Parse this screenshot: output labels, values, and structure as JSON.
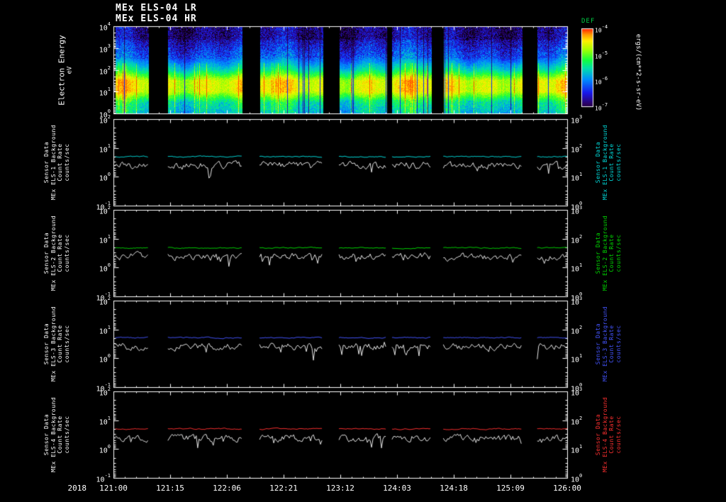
{
  "window": {
    "background": "#000000"
  },
  "header": {
    "title_line1": "MEx ELS-04 LR",
    "title_line2": "MEx ELS-04 HR"
  },
  "spectrogram": {
    "ylabel": "Electron Energy",
    "yunits": "eV",
    "ytick_exponents": [
      4,
      3,
      2,
      1,
      0
    ]
  },
  "colorbar": {
    "label": "DEF",
    "label_color": "#00cc44",
    "tick_exponents": [
      -4,
      -5,
      -6,
      -7
    ],
    "units": "ergs/(cm**2-s-sr-eV)"
  },
  "line_panels": [
    {
      "name": "MEx ELS-1 Background",
      "color": "#00dddd",
      "label_lines": [
        "Sensor Data",
        "MEx ELS-1 Background",
        "Count Rate",
        "counts/sec"
      ],
      "left_tick_exponents": [
        2,
        1,
        0,
        -1
      ],
      "right_tick_exponents": [
        3,
        2,
        1,
        0
      ]
    },
    {
      "name": "MEx ELS-2 Background",
      "color": "#00d800",
      "label_lines": [
        "Sensor Data",
        "MEx ELS-2 Background",
        "Count Rate",
        "counts/sec"
      ],
      "left_tick_exponents": [
        2,
        1,
        0,
        -1
      ],
      "right_tick_exponents": [
        3,
        2,
        1,
        0
      ]
    },
    {
      "name": "MEx ELS-3 Background",
      "color": "#4455ff",
      "label_lines": [
        "Sensor Data",
        "MEx ELS-3 Background",
        "Count Rate",
        "counts/sec"
      ],
      "left_tick_exponents": [
        2,
        1,
        0,
        -1
      ],
      "right_tick_exponents": [
        3,
        2,
        1,
        0
      ]
    },
    {
      "name": "MEx ELS-4 Background",
      "color": "#ff3030",
      "label_lines": [
        "Sensor Data",
        "MEx ELS-4 Background",
        "Count Rate",
        "counts/sec"
      ],
      "left_tick_exponents": [
        2,
        1,
        0,
        -1
      ],
      "right_tick_exponents": [
        3,
        2,
        1,
        0
      ]
    }
  ],
  "xaxis": {
    "year_label": "2018",
    "tick_labels": [
      "121:00",
      "121:15",
      "122:06",
      "122:21",
      "123:12",
      "124:03",
      "124:18",
      "125:09",
      "126:00"
    ]
  },
  "chart_data": {
    "type": "heatmap+line",
    "time_axis": {
      "year": 2018,
      "format": "DOY:HH",
      "tick_labels": [
        "121:00",
        "121:15",
        "122:06",
        "122:21",
        "123:12",
        "124:03",
        "124:18",
        "125:09",
        "126:00"
      ],
      "span_hours": 120,
      "hours_per_major_tick": 15
    },
    "data_segments_frac": [
      [
        0.004,
        0.078
      ],
      [
        0.12,
        0.283
      ],
      [
        0.322,
        0.462
      ],
      [
        0.497,
        0.602
      ],
      [
        0.614,
        0.7
      ],
      [
        0.727,
        0.9
      ],
      [
        0.934,
        1.0
      ]
    ],
    "spectrogram": {
      "type": "heatmap",
      "instrument": "MEx ELS-04",
      "y_scale": "log",
      "y_range_eV": [
        1,
        10000
      ],
      "z_label": "DEF",
      "z_units": "ergs/(cm**2-s-sr-eV)",
      "z_scale": "log",
      "z_range": [
        1e-07,
        0.0001
      ],
      "peak_flux_band_eV": [
        5,
        40
      ],
      "intensity_profile_log10eV_vs_rel": [
        [
          0.0,
          0.5
        ],
        [
          1.0,
          0.82
        ],
        [
          1.5,
          0.82
        ],
        [
          2.0,
          0.53
        ],
        [
          2.6,
          0.31
        ],
        [
          3.4,
          0.18
        ],
        [
          4.0,
          0.13
        ]
      ]
    },
    "line_series": [
      {
        "panel": 1,
        "name": "MEx ELS-1 Background Count Rate",
        "color": "cyan",
        "background_level_counts_per_sec": 5.0,
        "sensor_level_counts_per_sec": 2.5
      },
      {
        "panel": 2,
        "name": "MEx ELS-2 Background Count Rate",
        "color": "green",
        "background_level_counts_per_sec": 4.8,
        "sensor_level_counts_per_sec": 2.4
      },
      {
        "panel": 3,
        "name": "MEx ELS-3 Background Count Rate",
        "color": "blue",
        "background_level_counts_per_sec": 5.2,
        "sensor_level_counts_per_sec": 2.5
      },
      {
        "panel": 4,
        "name": "MEx ELS-4 Background Count Rate",
        "color": "red",
        "background_level_counts_per_sec": 5.0,
        "sensor_level_counts_per_sec": 2.4
      }
    ],
    "line_y_scale": "log",
    "y_axis_left_range": [
      0.1,
      100
    ],
    "y_axis_right_range": [
      1,
      1000
    ],
    "grid": false,
    "background": "black"
  }
}
